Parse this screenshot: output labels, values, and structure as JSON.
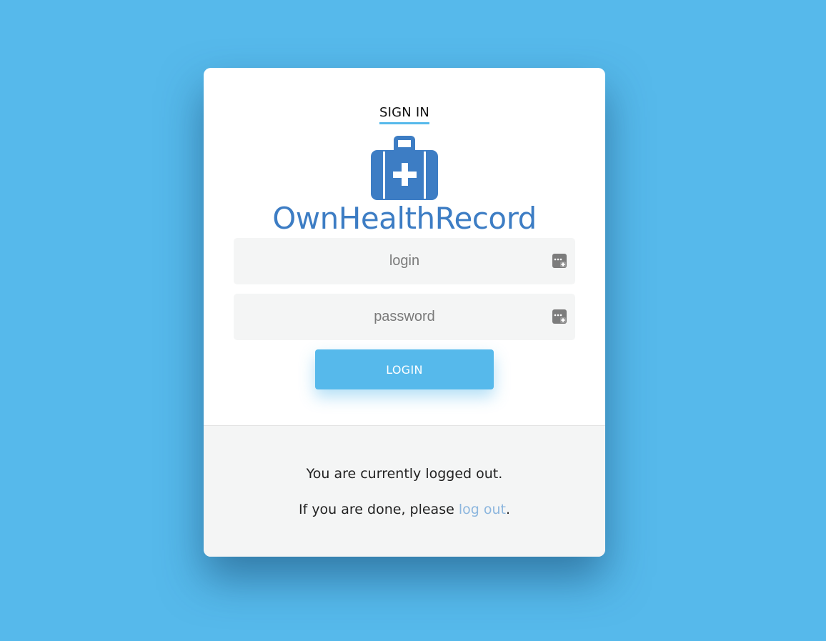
{
  "tab": {
    "label": "SIGN IN"
  },
  "brand": {
    "name": "OwnHealthRecord",
    "color": "#3d7dc4",
    "icon": "medical-kit-icon"
  },
  "form": {
    "login_placeholder": "login",
    "password_placeholder": "password",
    "field_icon": "password-manager-key-icon",
    "submit_label": "LOGIN"
  },
  "footer": {
    "status": "You are currently logged out.",
    "prompt_prefix": "If you are done, please ",
    "logout_link": "log out",
    "prompt_suffix": "."
  },
  "colors": {
    "background": "#56b9eb",
    "accent": "#56b9eb",
    "link": "#8cb6de"
  }
}
